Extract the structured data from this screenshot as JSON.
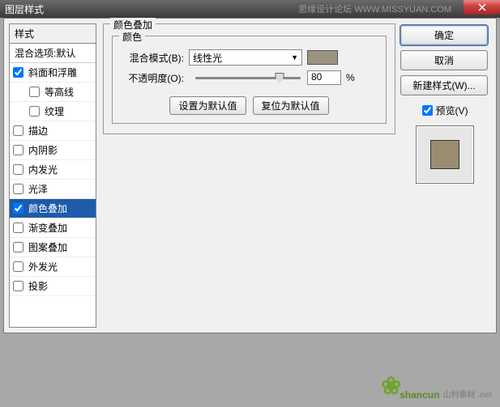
{
  "titlebar": {
    "title": "图层样式",
    "site": "思缘设计论坛  WWW.MISSYUAN.COM"
  },
  "styles": {
    "header": "样式",
    "blending": "混合选项:默认",
    "items": [
      {
        "label": "斜面和浮雕",
        "checked": true,
        "indent": false
      },
      {
        "label": "等高线",
        "checked": false,
        "indent": true
      },
      {
        "label": "纹理",
        "checked": false,
        "indent": true
      },
      {
        "label": "描边",
        "checked": false,
        "indent": false
      },
      {
        "label": "内阴影",
        "checked": false,
        "indent": false
      },
      {
        "label": "内发光",
        "checked": false,
        "indent": false
      },
      {
        "label": "光泽",
        "checked": false,
        "indent": false
      },
      {
        "label": "颜色叠加",
        "checked": true,
        "indent": false,
        "selected": true
      },
      {
        "label": "渐变叠加",
        "checked": false,
        "indent": false
      },
      {
        "label": "图案叠加",
        "checked": false,
        "indent": false
      },
      {
        "label": "外发光",
        "checked": false,
        "indent": false
      },
      {
        "label": "投影",
        "checked": false,
        "indent": false
      }
    ]
  },
  "center": {
    "section_title": "颜色叠加",
    "group_title": "颜色",
    "blend_label": "混合模式(B):",
    "blend_value": "线性光",
    "opacity_label": "不透明度(O):",
    "opacity_value": "80",
    "opacity_unit": "%",
    "set_default": "设置为默认值",
    "reset_default": "复位为默认值",
    "swatch_color": "#9b9281"
  },
  "right": {
    "ok": "确定",
    "cancel": "取消",
    "new_style": "新建样式(W)...",
    "preview": "预览(V)"
  },
  "watermark": {
    "text": "shancun",
    "sub": "山村素材\n.net"
  }
}
